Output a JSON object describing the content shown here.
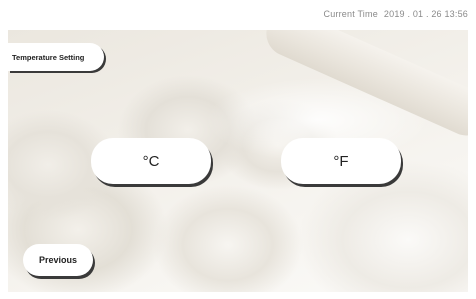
{
  "header": {
    "clock_label": "Current Time",
    "clock_value": "2019 . 01 . 26  13:56"
  },
  "screen": {
    "section_title": "Temperature Setting",
    "unit_celsius_label": "°C",
    "unit_fahrenheit_label": "°F",
    "previous_label": "Previous"
  }
}
